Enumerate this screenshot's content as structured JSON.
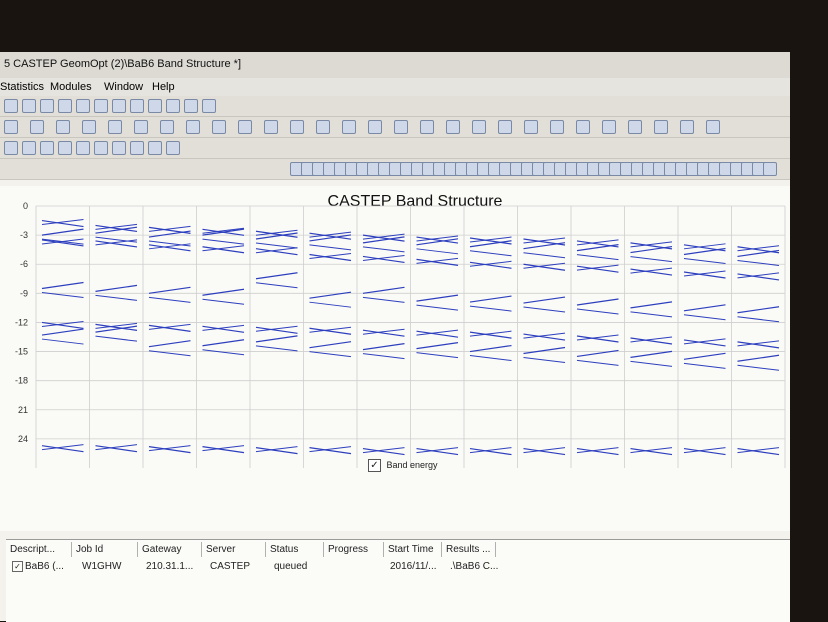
{
  "window": {
    "title": "5 CASTEP GeomOpt (2)\\BaB6 Band Structure *]"
  },
  "menu": [
    "Statistics",
    "Modules",
    "Window",
    "Help"
  ],
  "window_buttons": {
    "minimize": "–",
    "restore": "▭",
    "close": "✕"
  },
  "colors": {
    "band": "#2d3fbf",
    "grid": "#cfcfcf",
    "background": "#fafaf6"
  },
  "chart_data": {
    "type": "line",
    "title": "CASTEP Band Structure",
    "xlabel": "",
    "ylabel": "",
    "y_ticks": [
      "0",
      "-3",
      "-6",
      "-9",
      "-12",
      "-15",
      "-18",
      "21",
      "24"
    ],
    "ylim": [
      -27,
      0
    ],
    "grid": true,
    "legend": {
      "label": "Band energy",
      "checked": true,
      "placement": "bottom-center"
    },
    "segments": [
      {
        "bands": [
          -1.5,
          -3.0,
          -3.5,
          -8.5,
          -12.0,
          -13.3,
          -24.7
        ]
      },
      {
        "bands": [
          -2.0,
          -2.8,
          -3.6,
          -8.8,
          -12.2,
          -13.0,
          -24.7
        ]
      },
      {
        "bands": [
          -2.2,
          -3.2,
          -4.0,
          -9.0,
          -12.3,
          -14.5,
          -24.8
        ]
      },
      {
        "bands": [
          -2.4,
          -3.0,
          -4.2,
          -9.2,
          -12.4,
          -14.4,
          -24.8
        ]
      },
      {
        "bands": [
          -2.6,
          -3.4,
          -4.4,
          -7.5,
          -12.5,
          -14.0,
          -24.9
        ]
      },
      {
        "bands": [
          -2.8,
          -3.6,
          -5.0,
          -9.5,
          -12.6,
          -14.6,
          -24.9
        ]
      },
      {
        "bands": [
          -3.0,
          -3.8,
          -5.2,
          -9.0,
          -12.8,
          -14.8,
          -25.0
        ]
      },
      {
        "bands": [
          -3.2,
          -4.0,
          -5.5,
          -9.8,
          -12.9,
          -14.7,
          -25.0
        ]
      },
      {
        "bands": [
          -3.3,
          -4.2,
          -5.8,
          -9.9,
          -13.0,
          -15.0,
          -25.0
        ]
      },
      {
        "bands": [
          -3.4,
          -4.4,
          -6.0,
          -10.0,
          -13.2,
          -15.2,
          -25.0
        ]
      },
      {
        "bands": [
          -3.6,
          -4.6,
          -6.2,
          -10.2,
          -13.4,
          -15.5,
          -25.0
        ]
      },
      {
        "bands": [
          -3.8,
          -4.8,
          -6.5,
          -10.5,
          -13.6,
          -15.6,
          -25.0
        ]
      },
      {
        "bands": [
          -4.0,
          -5.0,
          -6.8,
          -10.8,
          -13.8,
          -15.8,
          -25.0
        ]
      },
      {
        "bands": [
          -4.2,
          -5.2,
          -7.0,
          -11.0,
          -14.0,
          -16.0,
          -25.0
        ]
      }
    ]
  },
  "jobs": {
    "columns": [
      "Descript...",
      "Job Id",
      "Gateway",
      "Server",
      "Status",
      "Progress",
      "Start Time",
      "Results ..."
    ],
    "rows": [
      [
        "BaB6 (...",
        "W1GHW",
        "210.31.1...",
        "CASTEP",
        "queued",
        "",
        "2016/11/...",
        ".\\BaB6 C..."
      ]
    ]
  }
}
